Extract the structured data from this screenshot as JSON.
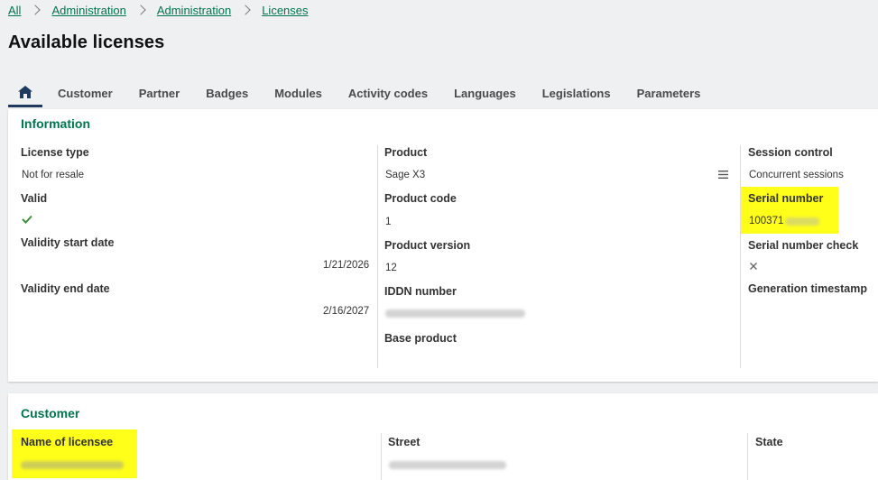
{
  "breadcrumb": {
    "items": [
      "All",
      "Administration",
      "Administration",
      "Licenses"
    ]
  },
  "page": {
    "title": "Available licenses"
  },
  "tabs": [
    "Customer",
    "Partner",
    "Badges",
    "Modules",
    "Activity codes",
    "Languages",
    "Legislations",
    "Parameters"
  ],
  "information": {
    "title": "Information",
    "license_type_label": "License type",
    "license_type_value": "Not for resale",
    "valid_label": "Valid",
    "validity_start_label": "Validity start date",
    "validity_start_value": "1/21/2026",
    "validity_end_label": "Validity end date",
    "validity_end_value": "2/16/2027",
    "product_label": "Product",
    "product_value": "Sage X3",
    "product_code_label": "Product code",
    "product_code_value": "1",
    "product_version_label": "Product version",
    "product_version_value": "12",
    "iddn_label": "IDDN number",
    "base_product_label": "Base product",
    "session_control_label": "Session control",
    "session_control_value": "Concurrent sessions",
    "serial_number_label": "Serial number",
    "serial_number_value": "100371",
    "serial_check_label": "Serial number check",
    "generation_timestamp_label": "Generation timestamp"
  },
  "customer": {
    "title": "Customer",
    "licensee_label": "Name of licensee",
    "street_label": "Street",
    "state_label": "State"
  },
  "colors": {
    "accent": "#00744e",
    "highlight": "#ffff1a",
    "tab_indicator": "#1e3a5f"
  },
  "icons": {
    "home": "home-icon",
    "menu": "menu-icon",
    "valid": "check-icon",
    "serial_check": "cross-icon"
  }
}
